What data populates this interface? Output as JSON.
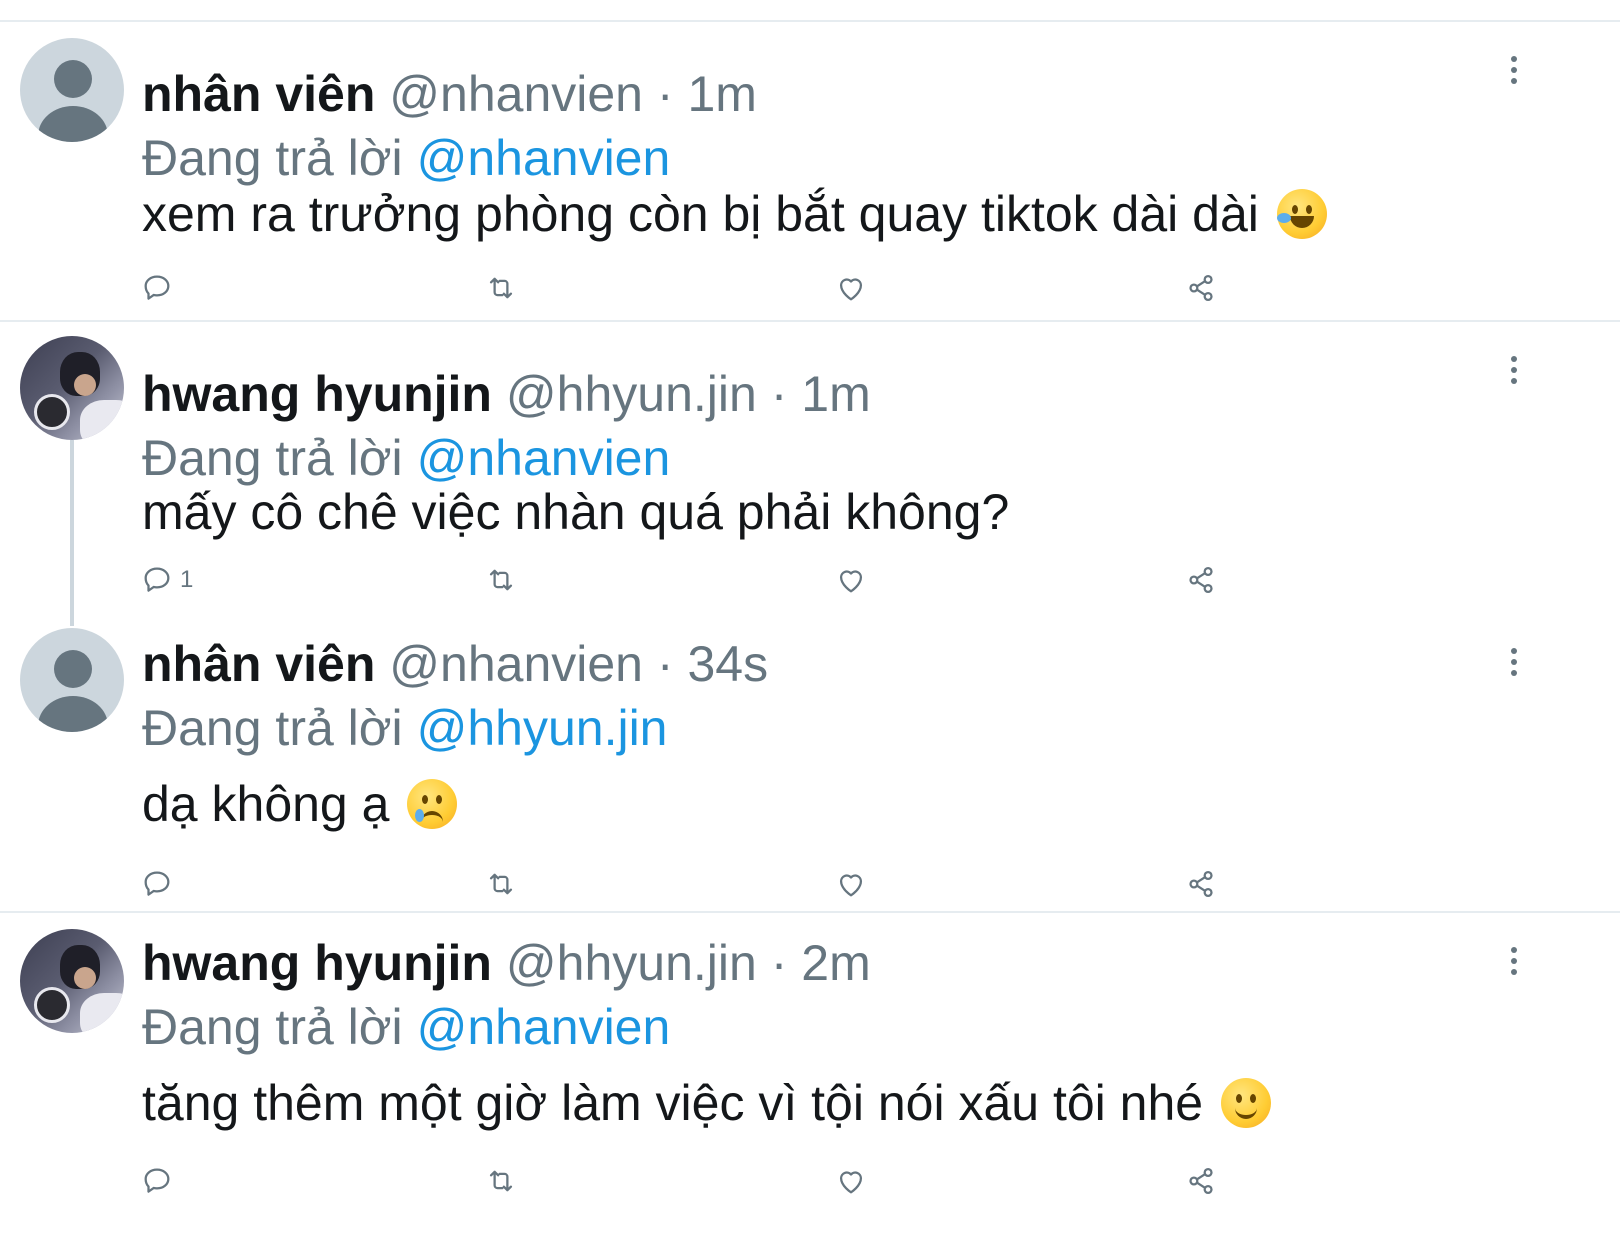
{
  "tweets": [
    {
      "display_name": "nhân viên",
      "handle": "@nhanvien",
      "time_sep": "·",
      "time": "1m",
      "reply_prefix": "Đang trả lời",
      "reply_to": "@nhanvien",
      "text": "xem ra trưởng phòng còn bị bắt quay tiktok dài dài",
      "emoji": "rolling-on-floor-laughing-emoji",
      "avatar": "default-avatar",
      "reply_count": ""
    },
    {
      "display_name": "hwang hyunjin",
      "handle": "@hhyun.jin",
      "time_sep": "·",
      "time": "1m",
      "reply_prefix": "Đang trả lời",
      "reply_to": "@nhanvien",
      "text": "mấy cô chê việc nhàn quá phải không?",
      "emoji": "",
      "avatar": "photo-avatar",
      "reply_count": "1"
    },
    {
      "display_name": "nhân viên",
      "handle": "@nhanvien",
      "time_sep": "·",
      "time": "34s",
      "reply_prefix": "Đang trả lời",
      "reply_to": "@hhyun.jin",
      "text": "dạ không ạ",
      "emoji": "face-holding-back-tears-emoji",
      "avatar": "default-avatar",
      "reply_count": ""
    },
    {
      "display_name": "hwang hyunjin",
      "handle": "@hhyun.jin",
      "time_sep": "·",
      "time": "2m",
      "reply_prefix": "Đang trả lời",
      "reply_to": "@nhanvien",
      "text": "tăng thêm một giờ làm việc vì tội nói xấu tôi nhé",
      "emoji": "slightly-smiling-face-emoji",
      "avatar": "photo-avatar",
      "reply_count": ""
    }
  ],
  "colors": {
    "text_primary": "#14171a",
    "text_secondary": "#66757f",
    "mention": "#1b95e0",
    "separator": "#e6ecf0",
    "icon": "#66757f"
  },
  "icons": [
    "reply-icon",
    "retweet-icon",
    "like-icon",
    "share-icon",
    "more-options-icon"
  ]
}
